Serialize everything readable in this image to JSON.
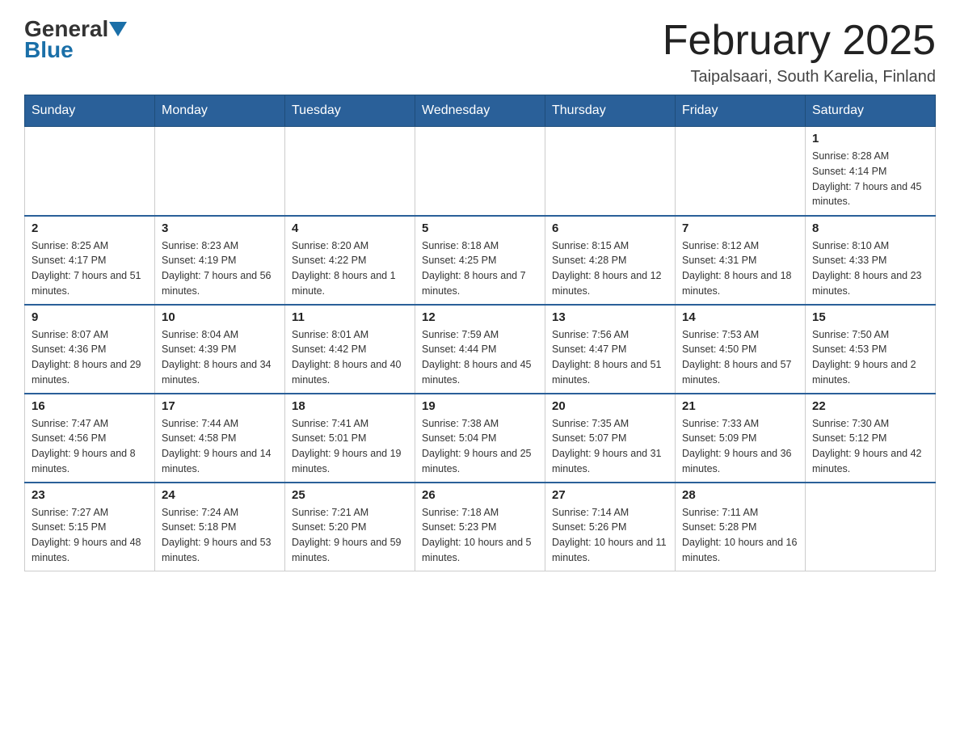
{
  "header": {
    "logo_general": "General",
    "logo_blue": "Blue",
    "month_title": "February 2025",
    "location": "Taipalsaari, South Karelia, Finland"
  },
  "days_of_week": [
    "Sunday",
    "Monday",
    "Tuesday",
    "Wednesday",
    "Thursday",
    "Friday",
    "Saturday"
  ],
  "weeks": [
    [
      {
        "day": "",
        "info": ""
      },
      {
        "day": "",
        "info": ""
      },
      {
        "day": "",
        "info": ""
      },
      {
        "day": "",
        "info": ""
      },
      {
        "day": "",
        "info": ""
      },
      {
        "day": "",
        "info": ""
      },
      {
        "day": "1",
        "info": "Sunrise: 8:28 AM\nSunset: 4:14 PM\nDaylight: 7 hours and 45 minutes."
      }
    ],
    [
      {
        "day": "2",
        "info": "Sunrise: 8:25 AM\nSunset: 4:17 PM\nDaylight: 7 hours and 51 minutes."
      },
      {
        "day": "3",
        "info": "Sunrise: 8:23 AM\nSunset: 4:19 PM\nDaylight: 7 hours and 56 minutes."
      },
      {
        "day": "4",
        "info": "Sunrise: 8:20 AM\nSunset: 4:22 PM\nDaylight: 8 hours and 1 minute."
      },
      {
        "day": "5",
        "info": "Sunrise: 8:18 AM\nSunset: 4:25 PM\nDaylight: 8 hours and 7 minutes."
      },
      {
        "day": "6",
        "info": "Sunrise: 8:15 AM\nSunset: 4:28 PM\nDaylight: 8 hours and 12 minutes."
      },
      {
        "day": "7",
        "info": "Sunrise: 8:12 AM\nSunset: 4:31 PM\nDaylight: 8 hours and 18 minutes."
      },
      {
        "day": "8",
        "info": "Sunrise: 8:10 AM\nSunset: 4:33 PM\nDaylight: 8 hours and 23 minutes."
      }
    ],
    [
      {
        "day": "9",
        "info": "Sunrise: 8:07 AM\nSunset: 4:36 PM\nDaylight: 8 hours and 29 minutes."
      },
      {
        "day": "10",
        "info": "Sunrise: 8:04 AM\nSunset: 4:39 PM\nDaylight: 8 hours and 34 minutes."
      },
      {
        "day": "11",
        "info": "Sunrise: 8:01 AM\nSunset: 4:42 PM\nDaylight: 8 hours and 40 minutes."
      },
      {
        "day": "12",
        "info": "Sunrise: 7:59 AM\nSunset: 4:44 PM\nDaylight: 8 hours and 45 minutes."
      },
      {
        "day": "13",
        "info": "Sunrise: 7:56 AM\nSunset: 4:47 PM\nDaylight: 8 hours and 51 minutes."
      },
      {
        "day": "14",
        "info": "Sunrise: 7:53 AM\nSunset: 4:50 PM\nDaylight: 8 hours and 57 minutes."
      },
      {
        "day": "15",
        "info": "Sunrise: 7:50 AM\nSunset: 4:53 PM\nDaylight: 9 hours and 2 minutes."
      }
    ],
    [
      {
        "day": "16",
        "info": "Sunrise: 7:47 AM\nSunset: 4:56 PM\nDaylight: 9 hours and 8 minutes."
      },
      {
        "day": "17",
        "info": "Sunrise: 7:44 AM\nSunset: 4:58 PM\nDaylight: 9 hours and 14 minutes."
      },
      {
        "day": "18",
        "info": "Sunrise: 7:41 AM\nSunset: 5:01 PM\nDaylight: 9 hours and 19 minutes."
      },
      {
        "day": "19",
        "info": "Sunrise: 7:38 AM\nSunset: 5:04 PM\nDaylight: 9 hours and 25 minutes."
      },
      {
        "day": "20",
        "info": "Sunrise: 7:35 AM\nSunset: 5:07 PM\nDaylight: 9 hours and 31 minutes."
      },
      {
        "day": "21",
        "info": "Sunrise: 7:33 AM\nSunset: 5:09 PM\nDaylight: 9 hours and 36 minutes."
      },
      {
        "day": "22",
        "info": "Sunrise: 7:30 AM\nSunset: 5:12 PM\nDaylight: 9 hours and 42 minutes."
      }
    ],
    [
      {
        "day": "23",
        "info": "Sunrise: 7:27 AM\nSunset: 5:15 PM\nDaylight: 9 hours and 48 minutes."
      },
      {
        "day": "24",
        "info": "Sunrise: 7:24 AM\nSunset: 5:18 PM\nDaylight: 9 hours and 53 minutes."
      },
      {
        "day": "25",
        "info": "Sunrise: 7:21 AM\nSunset: 5:20 PM\nDaylight: 9 hours and 59 minutes."
      },
      {
        "day": "26",
        "info": "Sunrise: 7:18 AM\nSunset: 5:23 PM\nDaylight: 10 hours and 5 minutes."
      },
      {
        "day": "27",
        "info": "Sunrise: 7:14 AM\nSunset: 5:26 PM\nDaylight: 10 hours and 11 minutes."
      },
      {
        "day": "28",
        "info": "Sunrise: 7:11 AM\nSunset: 5:28 PM\nDaylight: 10 hours and 16 minutes."
      },
      {
        "day": "",
        "info": ""
      }
    ]
  ],
  "accent_color": "#2a6099"
}
